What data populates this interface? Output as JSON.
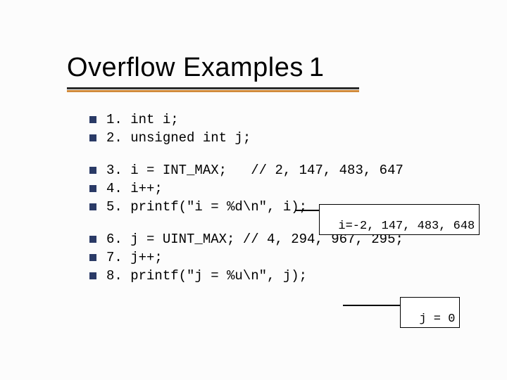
{
  "title": {
    "main": "Overflow Examples",
    "suffix": "1"
  },
  "groups": [
    [
      "1. int i;",
      "2. unsigned int j;"
    ],
    [
      "3. i = INT_MAX;   // 2, 147, 483, 647",
      "4. i++;",
      "5. printf(\"i = %d\\n\", i);"
    ],
    [
      "6. j = UINT_MAX; // 4, 294, 967, 295;",
      "7. j++;",
      "8. printf(\"j = %u\\n\", j);"
    ]
  ],
  "callouts": {
    "c1": "i=-2, 147, 483, 648",
    "c2": "j = 0"
  }
}
